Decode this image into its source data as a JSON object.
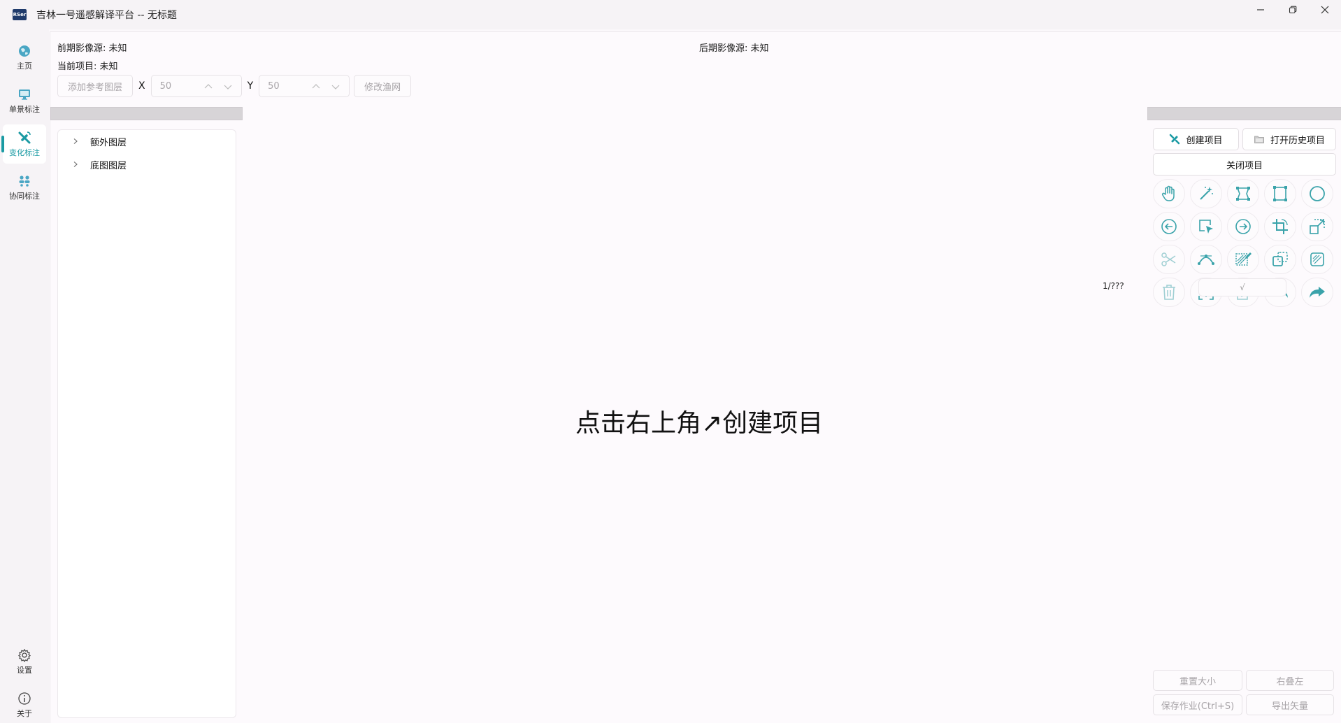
{
  "window": {
    "logo_text": "RSer",
    "title": "吉林一号遥感解译平台 -- 无标题"
  },
  "nav": {
    "items": [
      {
        "label": "主页",
        "icon": "globe-icon"
      },
      {
        "label": "单景标注",
        "icon": "monitor-icon"
      },
      {
        "label": "变化标注",
        "icon": "satellite-icon",
        "active": true
      },
      {
        "label": "协同标注",
        "icon": "collab-icon"
      }
    ],
    "bottom": [
      {
        "label": "设置",
        "icon": "gear-icon"
      },
      {
        "label": "关于",
        "icon": "info-icon"
      }
    ]
  },
  "info": {
    "prev_source": "前期影像源:  未知",
    "post_source": "后期影像源:  未知",
    "current_project": "当前项目:  未知"
  },
  "toolbar": {
    "add_ref_layer": "添加参考图层",
    "x_label": "X",
    "x_value": "50",
    "y_label": "Y",
    "y_value": "50",
    "modify_grid": "修改渔网"
  },
  "tree": {
    "items": [
      "额外图层",
      "底图图层"
    ]
  },
  "center_message": "点击右上角↗创建项目",
  "right_panel": {
    "create_project": "创建项目",
    "open_history": "打开历史项目",
    "close_project": "关闭项目",
    "tools": [
      "hand-icon",
      "magic-wand-icon",
      "polygon-nodes-icon",
      "rectangle-icon",
      "circle-icon",
      "arrow-left-circle-icon",
      "select-box-icon",
      "arrow-right-circle-icon",
      "crop-icon",
      "resize-icon",
      "scissors-icon",
      "curve-icon",
      "hatch-edit-icon",
      "copy-shape-icon",
      "hatch-square-icon",
      "trash-icon",
      "split-merge-icon",
      "edit-note-icon",
      "undo-icon",
      "redo-icon"
    ],
    "counter": "1/???",
    "confirm": "√"
  },
  "bottom_actions": {
    "reset_size": "重置大小",
    "right_over_left": "右叠左",
    "save_work": "保存作业(Ctrl+S)",
    "export_vector": "导出矢量"
  },
  "colors": {
    "accent": "#1a9aa3",
    "tool_icon": "#3aa3aa"
  }
}
